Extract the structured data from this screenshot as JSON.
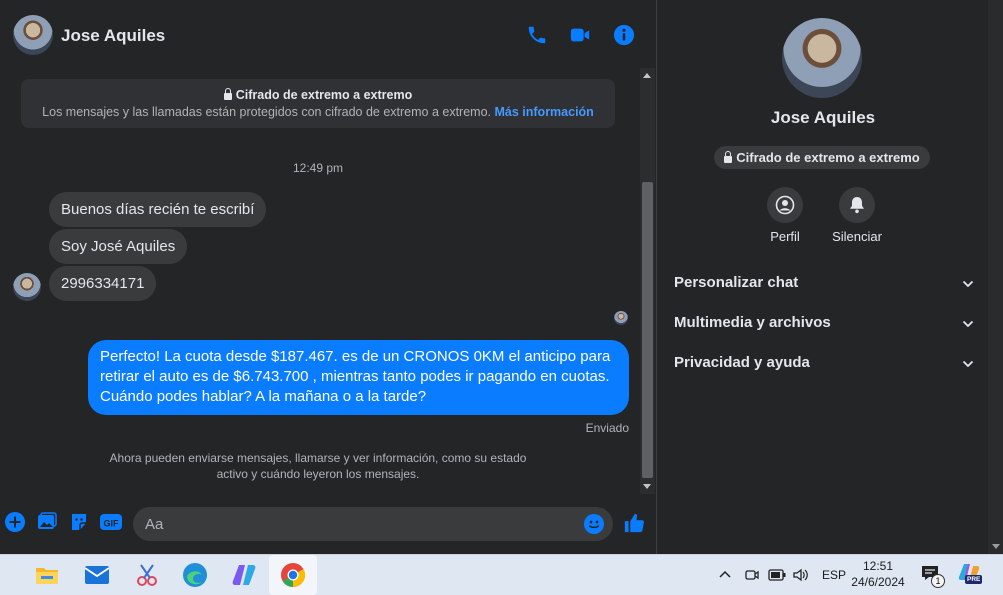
{
  "contact": {
    "name": "Jose Aquiles"
  },
  "encryption_banner": {
    "title": "Cifrado de extremo a extremo",
    "text": "Los mensajes y las llamadas están protegidos con cifrado de extremo a extremo.",
    "link": "Más información"
  },
  "timestamp": "12:49 pm",
  "messages_in": [
    "Buenos días recién te escribí",
    "Soy José Aquiles",
    "2996334171"
  ],
  "message_out": "Perfecto! La cuota desde $187.467. es de un CRONOS 0KM el anticipo para retirar el auto es de $6.743.700 , mientras tanto podes ir pagando en cuotas. Cuándo podes hablar? A la mañana o a la tarde?",
  "status": "Enviado",
  "footnote": "Ahora pueden enviarse mensajes, llamarse y ver información, como su estado activo y cuándo leyeron los mensajes.",
  "composer": {
    "placeholder": "Aa",
    "gif_label": "GIF"
  },
  "sidebar": {
    "name": "Jose Aquiles",
    "encryption_pill": "Cifrado de extremo a extremo",
    "actions": [
      {
        "label": "Perfil",
        "icon": "profile-icon"
      },
      {
        "label": "Silenciar",
        "icon": "bell-icon"
      }
    ],
    "sections": [
      "Personalizar chat",
      "Multimedia y archivos",
      "Privacidad y ayuda"
    ]
  },
  "taskbar": {
    "apps": [
      "file-explorer-icon",
      "mail-icon",
      "snipping-tool-icon",
      "edge-icon",
      "copilot-icon",
      "chrome-icon"
    ],
    "language": "ESP",
    "time": "12:51",
    "date": "24/6/2024",
    "notification_count": "1",
    "copilot_badge": "PRE"
  },
  "colors": {
    "accent": "#0a7cff",
    "bg": "#242526",
    "bubble_in": "#3a3b3c",
    "link": "#4599ff"
  }
}
